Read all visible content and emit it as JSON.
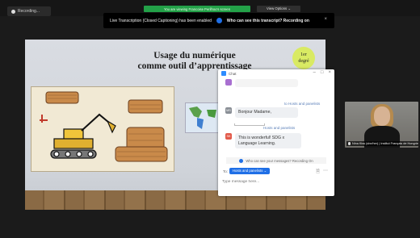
{
  "topbar": {
    "recording_label": "Recording...",
    "viewing_banner": "You are viewing Francoise Perilhou's screen",
    "view_options_label": "View Options ⌄"
  },
  "transcript_bar": {
    "message": "Live Transcription (Closed Captioning) has been enabled",
    "who_can_see": "Who can see this transcript? Recording on",
    "close_glyph": "×"
  },
  "slide": {
    "title_line1": "Usage du numérique",
    "title_line2": "comme outil d’apprentissage",
    "badge_line1": "1er",
    "badge_line2": "degré"
  },
  "chat": {
    "window_title": "Chat",
    "to_hosts_1": "to Hosts and panelists",
    "messages": [
      {
        "initials": "MS",
        "avatar_color": "#8a8f96",
        "text": "Bonjour Madame,"
      },
      {
        "initials": "SK",
        "avatar_color": "#e25a4a",
        "text": "This is wonderful! SDG x Language Learning."
      }
    ],
    "to_hosts_2": "Hosts and panelists",
    "who_can_see": "Who can see your messages? Recording On",
    "to_label": "To:",
    "to_select": "Hosts and panelists ⌄",
    "input_placeholder": "Type message here..."
  },
  "video": {
    "name_tag": "Nina Kiss (she/her) | Institut Français de Hongrie"
  },
  "colors": {
    "accent": "#1f6fe6",
    "banner_green": "#23a148",
    "badge_yellow": "#d9ea63"
  }
}
